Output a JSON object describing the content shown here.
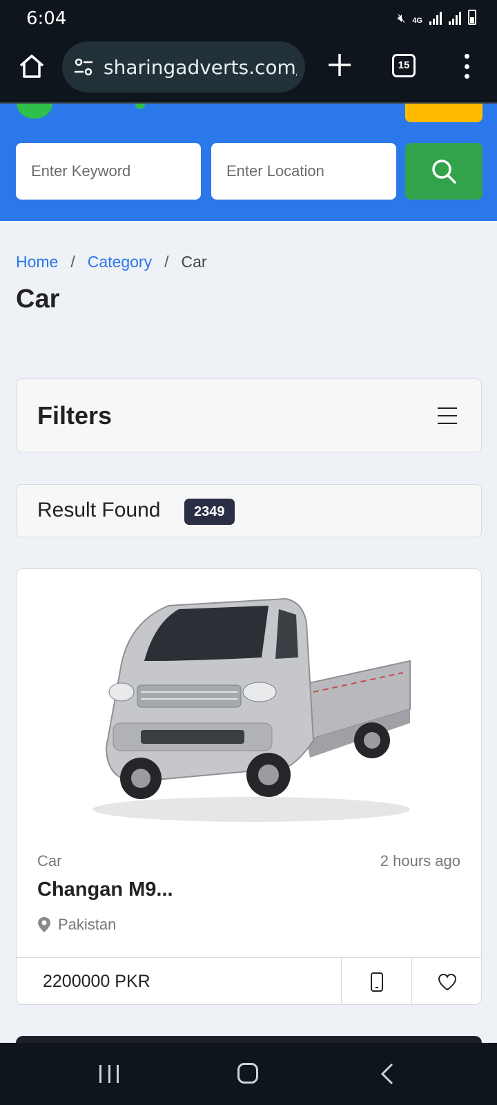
{
  "status_bar": {
    "time": "6:04",
    "network": "4G"
  },
  "browser": {
    "url": "sharingadverts.com/",
    "tab_count": "15"
  },
  "search": {
    "keyword_placeholder": "Enter Keyword",
    "location_placeholder": "Enter Location"
  },
  "breadcrumb": {
    "home": "Home",
    "separator": "/",
    "category": "Category",
    "current": "Car"
  },
  "page_title": "Car",
  "filters": {
    "title": "Filters"
  },
  "results": {
    "label": "Result Found",
    "count": "2349"
  },
  "listing": {
    "category": "Car",
    "time": "2 hours ago",
    "title": "Changan M9...",
    "location": "Pakistan",
    "price": "2200000 PKR"
  },
  "colors": {
    "header_blue": "#2a78ea",
    "search_green": "#33a34b",
    "post_yellow": "#ffbb00",
    "badge_dark": "#2b2f45",
    "system_bar": "#0f151c"
  },
  "icons": [
    "home-icon",
    "tune-icon",
    "plus-icon",
    "tabs-icon",
    "more-vert-icon",
    "search-icon",
    "hamburger-icon",
    "location-pin-icon",
    "phone-icon",
    "heart-icon"
  ]
}
